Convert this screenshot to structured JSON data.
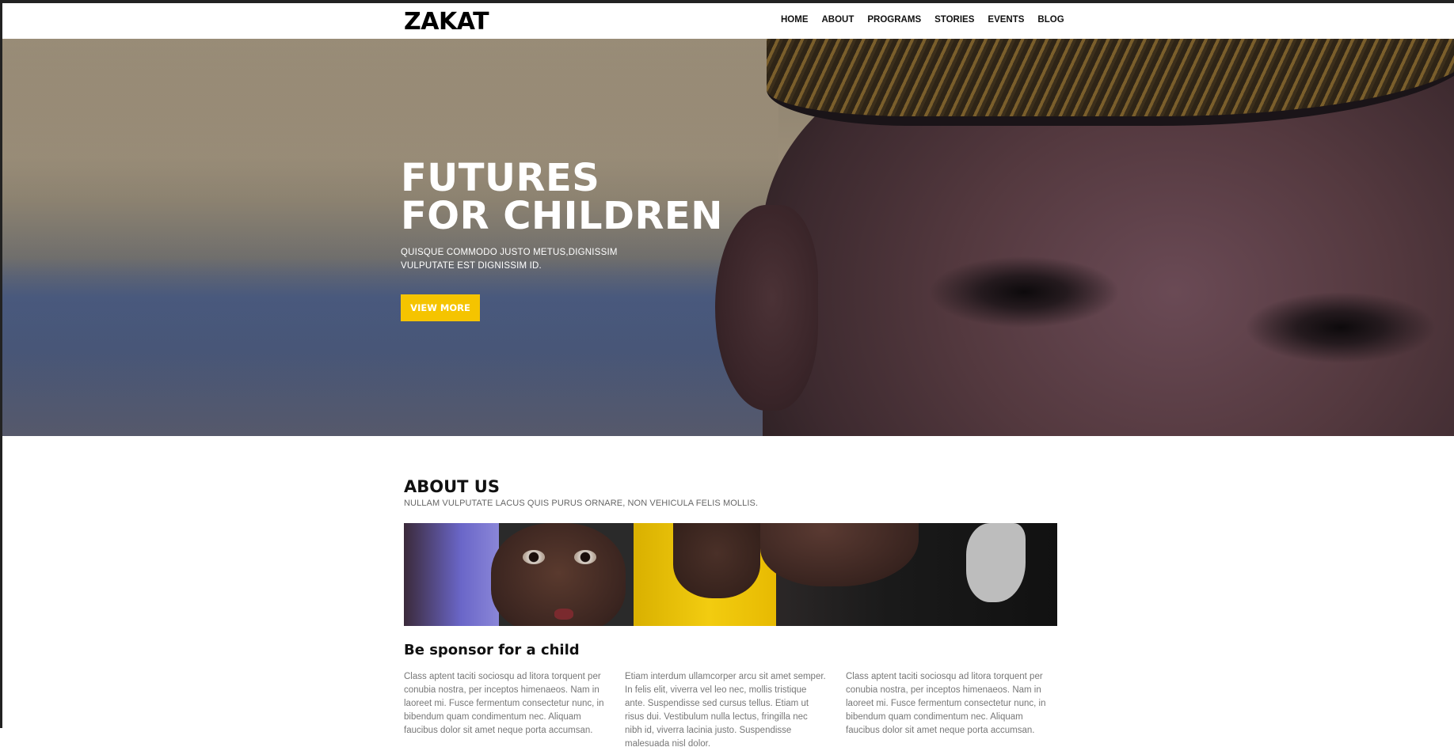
{
  "header": {
    "logo": "ZAKAT",
    "nav": [
      "HOME",
      "ABOUT",
      "PROGRAMS",
      "STORIES",
      "EVENTS",
      "BLOG"
    ]
  },
  "hero": {
    "title_line1": "FUTURES",
    "title_line2": "FOR CHILDREN",
    "subtitle_line1": "QUISQUE COMMODO JUSTO METUS,DIGNISSIM",
    "subtitle_line2": "VULPUTATE EST DIGNISSIM ID.",
    "button": "VIEW MORE",
    "button_color": "#f5c400"
  },
  "about": {
    "title": "ABOUT US",
    "subtitle": "NULLAM VULPUTATE LACUS QUIS PURUS ORNARE, NON VEHICULA FELIS MOLLIS.",
    "section_title": "Be sponsor for a child",
    "columns": [
      "Class aptent taciti sociosqu ad litora torquent per conubia nostra, per inceptos himenaeos. Nam in laoreet mi. Fusce fermentum consectetur nunc, in bibendum quam condimentum nec. Aliquam faucibus dolor sit amet neque porta accumsan.",
      "Etiam interdum ullamcorper arcu sit amet semper. In felis elit, viverra vel leo nec, mollis tristique ante. Suspendisse sed cursus tellus. Etiam ut risus dui. Vestibulum nulla lectus, fringilla nec nibh id, viverra lacinia justo. Suspendisse malesuada nisl dolor.",
      "Class aptent taciti sociosqu ad litora torquent per conubia nostra, per inceptos himenaeos. Nam in laoreet mi. Fusce fermentum consectetur nunc, in bibendum quam condimentum nec. Aliquam faucibus dolor sit amet neque porta accumsan."
    ]
  }
}
